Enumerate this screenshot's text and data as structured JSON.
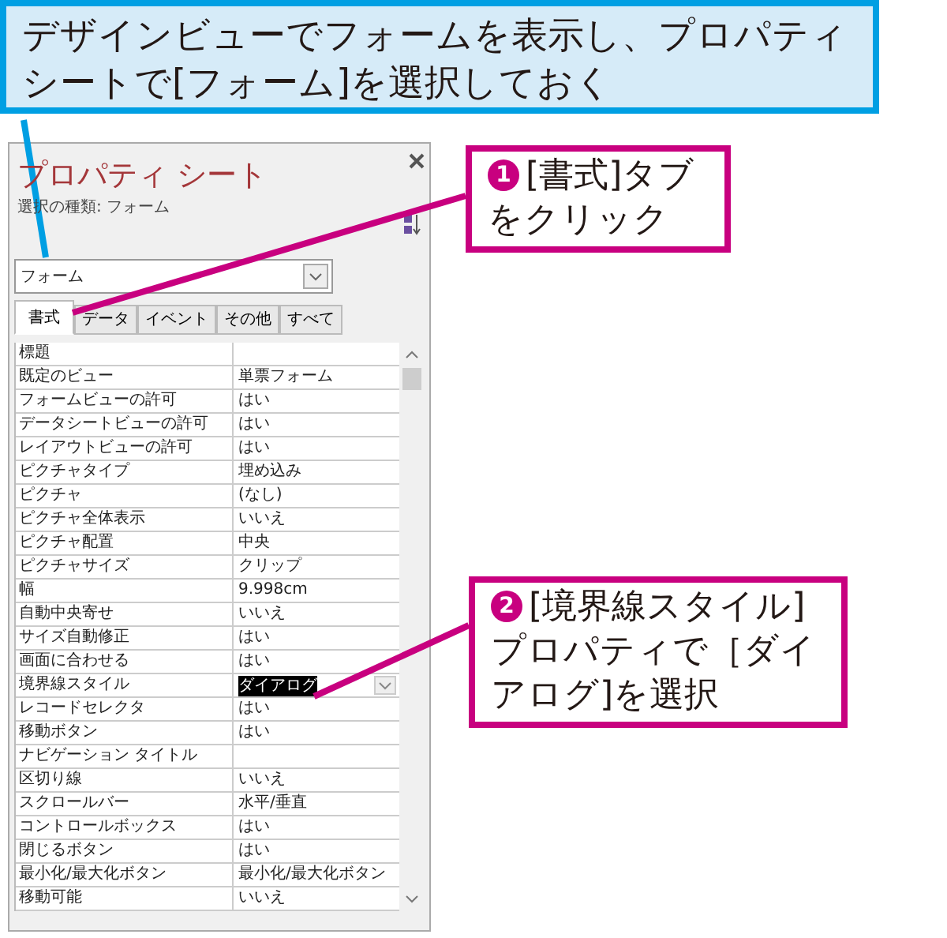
{
  "instruction_callout": {
    "text": "デザインビューでフォームを表示し、プロパティシートで[フォーム]を選択しておく"
  },
  "property_sheet": {
    "title": "プロパティ シート",
    "selection_type": "選択の種類: フォーム",
    "object_combo": {
      "value": "フォーム"
    },
    "tabs": [
      {
        "label": "書式",
        "selected": true
      },
      {
        "label": "データ",
        "selected": false
      },
      {
        "label": "イベント",
        "selected": false
      },
      {
        "label": "その他",
        "selected": false
      },
      {
        "label": "すべて",
        "selected": false
      }
    ],
    "rows": [
      {
        "name": "標題",
        "selected": false
      },
      {
        "name": "既定のビュー",
        "value": "単票フォーム",
        "selected": false
      },
      {
        "name": "フォームビューの許可",
        "value": "はい",
        "selected": false
      },
      {
        "name": "データシートビューの許可",
        "value": "はい",
        "selected": false
      },
      {
        "name": "レイアウトビューの許可",
        "value": "はい",
        "selected": false
      },
      {
        "name": "ピクチャタイプ",
        "value": "埋め込み",
        "selected": false
      },
      {
        "name": "ピクチャ",
        "value": "(なし)",
        "selected": false
      },
      {
        "name": "ピクチャ全体表示",
        "value": "いいえ",
        "selected": false
      },
      {
        "name": "ピクチャ配置",
        "value": "中央",
        "selected": false
      },
      {
        "name": "ピクチャサイズ",
        "value": "クリップ",
        "selected": false
      },
      {
        "name": "幅",
        "value": "9.998cm",
        "selected": false
      },
      {
        "name": "自動中央寄せ",
        "value": "いいえ",
        "selected": false
      },
      {
        "name": "サイズ自動修正",
        "value": "はい",
        "selected": false
      },
      {
        "name": "画面に合わせる",
        "value": "はい",
        "selected": false
      },
      {
        "name": "境界線スタイル",
        "value": "ダイアログ",
        "selected": true
      },
      {
        "name": "レコードセレクタ",
        "value": "はい",
        "selected": false
      },
      {
        "name": "移動ボタン",
        "value": "はい",
        "selected": false
      },
      {
        "name": "ナビゲーション タイトル",
        "selected": false
      },
      {
        "name": "区切り線",
        "value": "いいえ",
        "selected": false
      },
      {
        "name": "スクロールバー",
        "value": "水平/垂直",
        "selected": false
      },
      {
        "name": "コントロールボックス",
        "value": "はい",
        "selected": false
      },
      {
        "name": "閉じるボタン",
        "value": "はい",
        "selected": false
      },
      {
        "name": "最小化/最大化ボタン",
        "value": "最小化/最大化ボタン",
        "selected": false
      },
      {
        "name": "移動可能",
        "value": "いいえ",
        "selected": false
      }
    ]
  },
  "step_callouts": [
    {
      "step": "1",
      "lines": [
        "[書式]タブ",
        "をクリック"
      ]
    },
    {
      "step": "2",
      "lines": [
        "[境界線スタイル]",
        "プロパティで［ダイ",
        "アログ]を選択"
      ]
    }
  ]
}
